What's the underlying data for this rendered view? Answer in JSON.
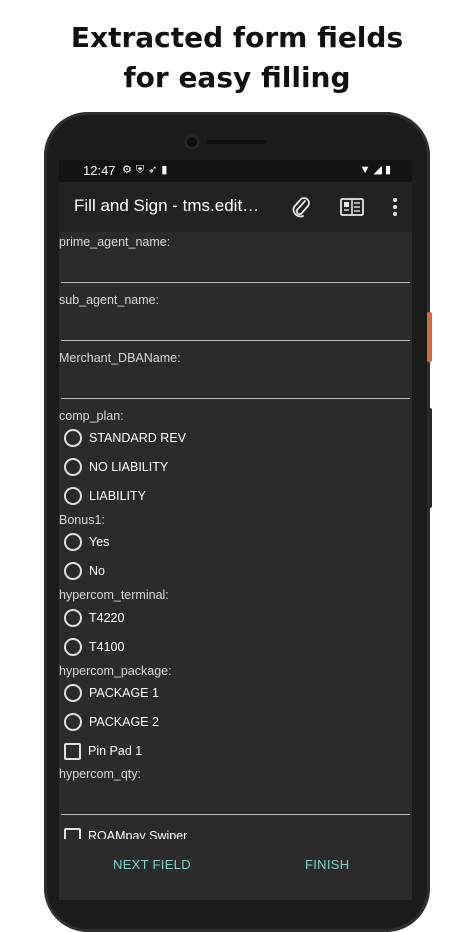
{
  "headline": [
    "Extracted form fields",
    "for easy filling"
  ],
  "status_bar": {
    "time": "12:47",
    "left_icons": [
      "gear-icon",
      "shield-icon",
      "nav-icon",
      "sim-icon"
    ],
    "right_icons": [
      "wifi-icon",
      "signal-icon",
      "battery-icon"
    ]
  },
  "app_bar": {
    "title": "Fill and Sign - tms.edit…",
    "actions": [
      "paperclip-icon",
      "reader-view-icon",
      "overflow-menu-icon"
    ]
  },
  "form": {
    "prime_agent_name": {
      "label": "prime_agent_name:",
      "value": ""
    },
    "sub_agent_name": {
      "label": "sub_agent_name:",
      "value": ""
    },
    "merchant_dba_name": {
      "label": "Merchant_DBAName:",
      "value": ""
    },
    "comp_plan": {
      "label": "comp_plan:",
      "options": [
        "STANDARD REV",
        "NO LIABILITY",
        "LIABILITY"
      ],
      "selected": null
    },
    "bonus1": {
      "label": "Bonus1:",
      "options": [
        "Yes",
        "No"
      ],
      "selected": null
    },
    "hypercom_terminal": {
      "label": "hypercom_terminal:",
      "options": [
        "T4220",
        "T4100"
      ],
      "selected": null
    },
    "hypercom_package": {
      "label": "hypercom_package:",
      "options": [
        "PACKAGE 1",
        "PACKAGE 2"
      ],
      "selected": null,
      "checkbox": {
        "label": "Pin Pad 1",
        "checked": false
      }
    },
    "hypercom_qty": {
      "label": "hypercom_qty:",
      "value": ""
    },
    "partial_checkbox": {
      "label": "ROAMpay Swiper",
      "checked": false
    }
  },
  "bottom_bar": {
    "next_field": "NEXT FIELD",
    "finish": "FINISH"
  },
  "colors": {
    "screen_bg": "#2b2b2b",
    "app_bar_bg": "#222222",
    "accent": "#7fd0c8",
    "underline": "#bdbdbd"
  }
}
